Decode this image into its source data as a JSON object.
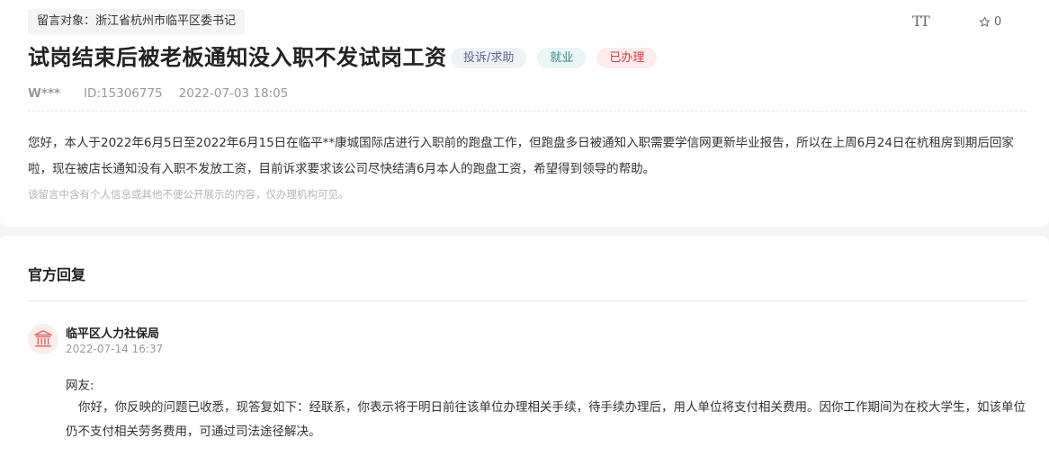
{
  "header": {
    "target_label": "留言对象：浙江省杭州市临平区委书记",
    "font_size_toggle": "TT",
    "favorite_count": "0"
  },
  "message": {
    "title": "试岗结束后被老板通知没入职不发试岗工资",
    "tags": {
      "type": "投诉/求助",
      "field": "就业",
      "status": "已办理"
    },
    "author": "W***",
    "id": "ID:15306775",
    "date": "2022-07-03 18:05",
    "content": "您好，本人于2022年6月5日至2022年6月15日在临平**康城国际店进行入职前的跑盘工作，但跑盘多日被通知入职需要学信网更新毕业报告，所以在上周6月24日在杭租房到期后回家啦，现在被店长通知没有入职不发放工资，目前诉求要求该公司尽快结清6月本人的跑盘工资，希望得到领导的帮助。",
    "notice": "该留言中含有个人信息或其他不便公开展示的内容，仅办理机构可见。"
  },
  "reply": {
    "section_title": "官方回复",
    "org_name": "临平区人力社保局",
    "time": "2022-07-14 16:37",
    "salutation": "网友:",
    "content": "你好，你反映的问题已收悉，现答复如下：经联系，你表示将于明日前往该单位办理相关手续，待手续办理后，用人单位将支付相关费用。因你工作期间为在校大学生，如该单位仍不支付相关劳务费用，可通过司法途径解决。"
  },
  "colors": {
    "status_red": "#d9363e",
    "field_teal": "#3c8a87",
    "type_slate": "#5a6b86",
    "icon_red": "#e07070"
  },
  "icons": [
    "font-size-icon",
    "star-icon",
    "government-building-icon"
  ]
}
